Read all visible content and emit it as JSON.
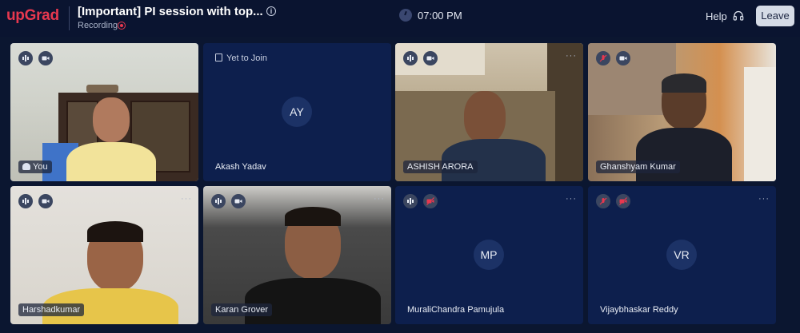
{
  "header": {
    "logo": "upGrad",
    "title": "[Important] PI session with top...",
    "recording_label": "Recording",
    "time": "07:00 PM",
    "help_label": "Help",
    "leave_label": "Leave"
  },
  "tiles": [
    {
      "name": "You",
      "video": true
    },
    {
      "name": "Akash Yadav",
      "status": "Yet to Join",
      "initials": "AY"
    },
    {
      "name": "ASHISH ARORA",
      "video": true
    },
    {
      "name": "Ghanshyam Kumar",
      "video": true
    },
    {
      "name": "Harshadkumar",
      "video": true
    },
    {
      "name": "Karan Grover",
      "video": true
    },
    {
      "name": "MuraliChandra Pamujula",
      "initials": "MP"
    },
    {
      "name": "Vijaybhaskar Reddy",
      "initials": "VR"
    }
  ],
  "colors": {
    "background": "#0b1630",
    "tile": "#0d1f4d",
    "brand": "#e8384f",
    "leave_button": "#d5dbe6"
  }
}
